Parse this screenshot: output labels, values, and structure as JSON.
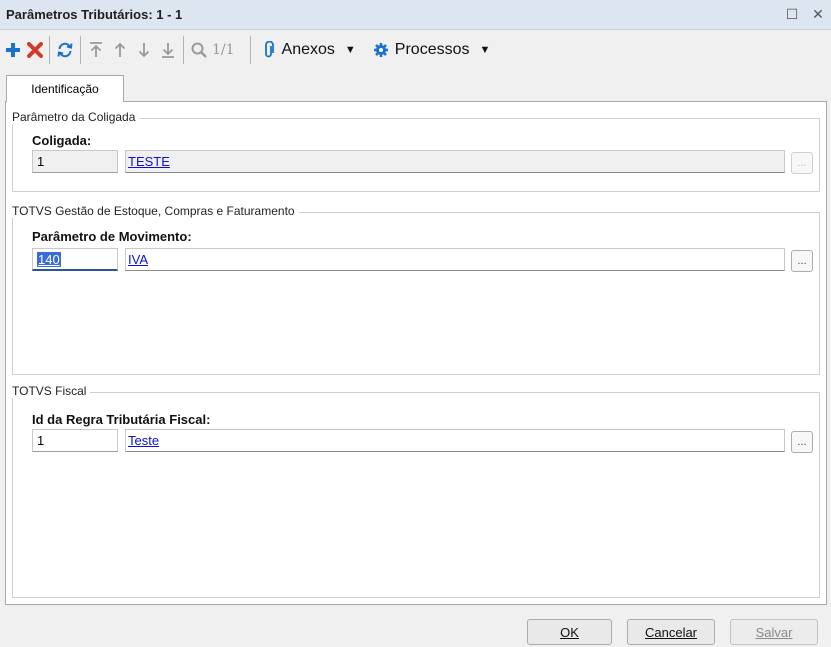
{
  "window": {
    "title": "Parâmetros Tributários: 1 - 1",
    "maximize_glyph": "☐",
    "close_glyph": "✕"
  },
  "toolbar": {
    "pager": "1/1",
    "attachments_label": "Anexos",
    "processes_label": "Processos",
    "caret": "▼",
    "icons": [
      "add-icon",
      "delete-icon",
      "refresh-icon",
      "first-record-icon",
      "previous-record-icon",
      "next-record-icon",
      "last-record-icon",
      "search-icon",
      "paperclip-icon",
      "gear-icon"
    ]
  },
  "tabs": [
    {
      "label": "Identificação",
      "active": true
    }
  ],
  "groups": {
    "coligada": {
      "title": "Parâmetro da Coligada",
      "field_label": "Coligada:",
      "code": "1",
      "description": "TESTE",
      "lookup": "..."
    },
    "estoque": {
      "title": "TOTVS Gestão de Estoque, Compras e Faturamento",
      "field_label": "Parâmetro de Movimento:",
      "code": "140",
      "description": "IVA",
      "lookup": "..."
    },
    "fiscal": {
      "title": "TOTVS Fiscal",
      "field_label": "Id da Regra Tributária Fiscal:",
      "code": "1",
      "description": "Teste",
      "lookup": "..."
    }
  },
  "footer": {
    "ok_label": "OK",
    "cancel_label": "Cancelar",
    "save_label": "Salvar"
  },
  "colors": {
    "accent_blue": "#1a73c9",
    "delete_red": "#d23a2a",
    "link_blue": "#0b10d6",
    "selection_blue": "#3b6bd8"
  }
}
